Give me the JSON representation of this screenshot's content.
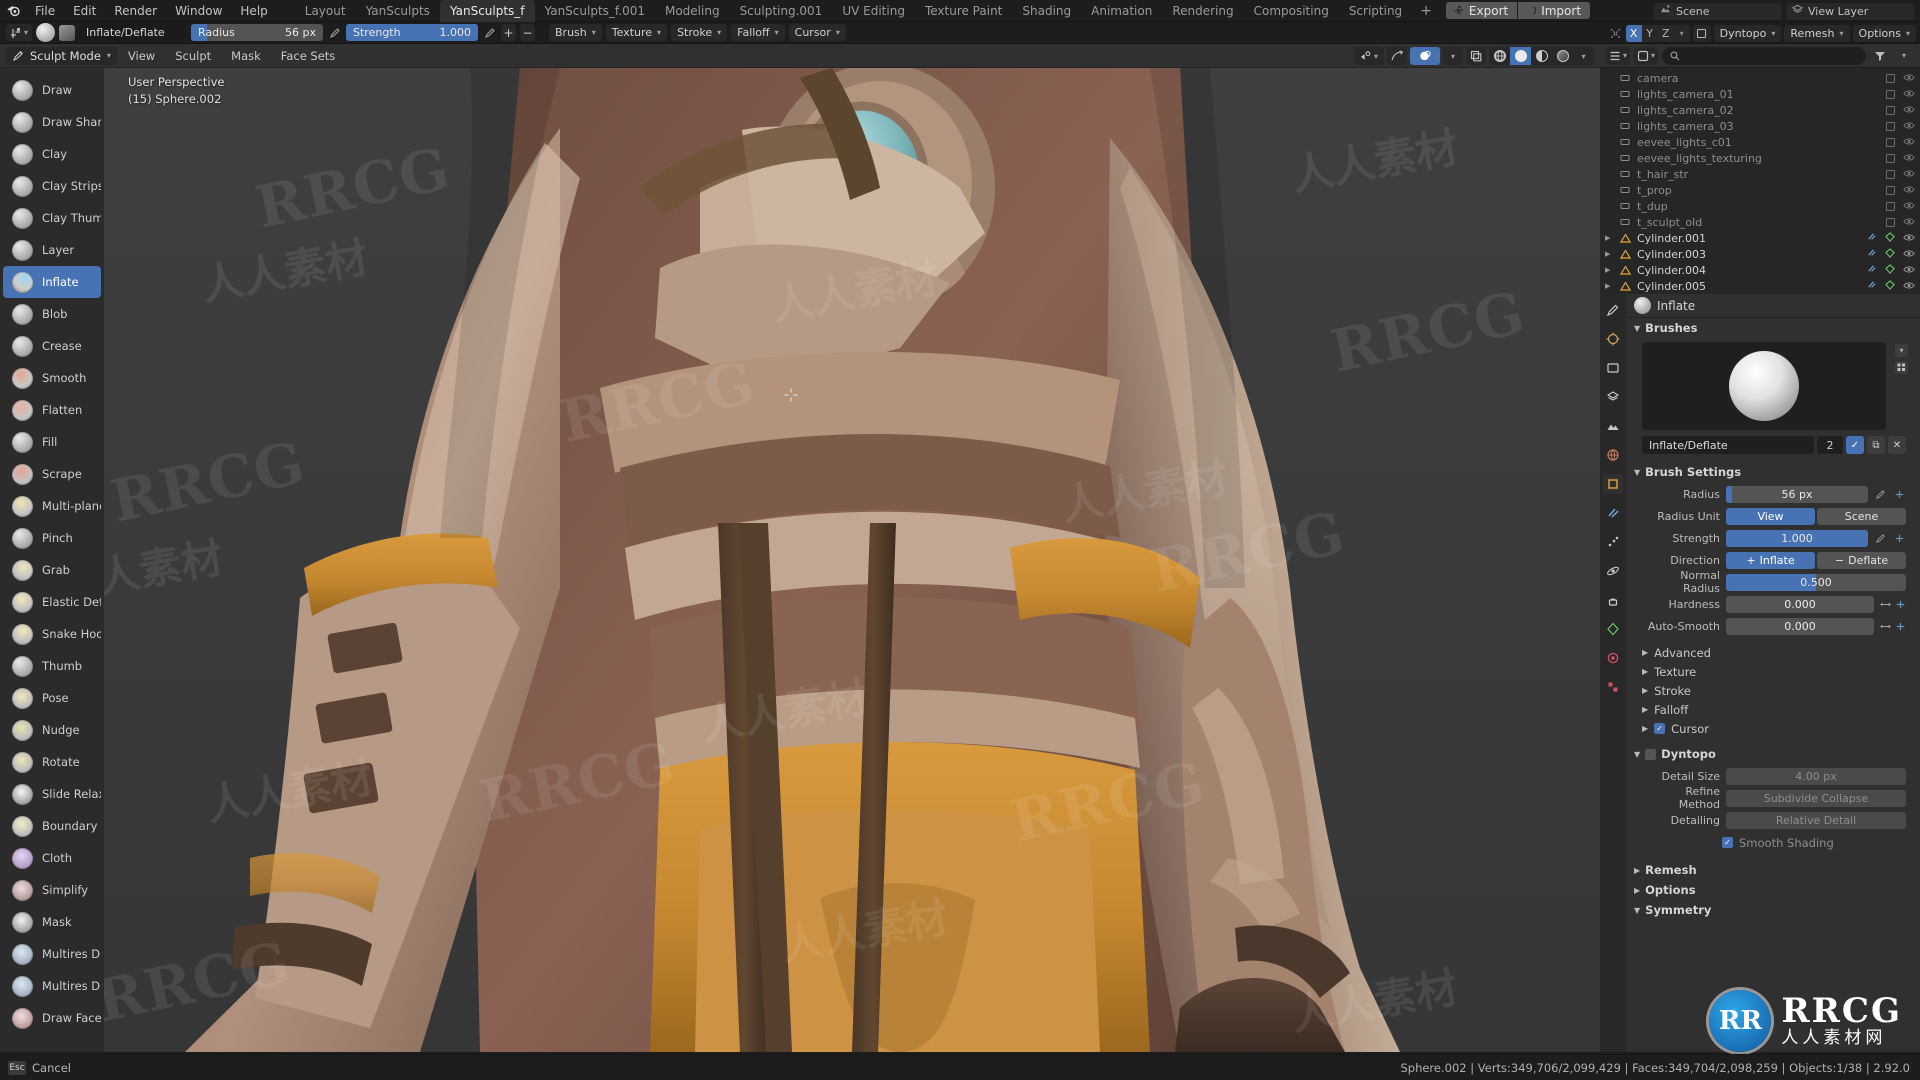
{
  "app": {
    "menus": [
      "File",
      "Edit",
      "Render",
      "Window",
      "Help"
    ],
    "workspace_tabs": [
      {
        "label": "Layout",
        "active": false
      },
      {
        "label": "YanSculpts",
        "active": false
      },
      {
        "label": "YanSculpts_f",
        "active": true
      },
      {
        "label": "YanSculpts_f.001",
        "active": false
      },
      {
        "label": "Modeling",
        "active": false
      },
      {
        "label": "Sculpting.001",
        "active": false
      },
      {
        "label": "UV Editing",
        "active": false
      },
      {
        "label": "Texture Paint",
        "active": false
      },
      {
        "label": "Shading",
        "active": false
      },
      {
        "label": "Animation",
        "active": false
      },
      {
        "label": "Rendering",
        "active": false
      },
      {
        "label": "Compositing",
        "active": false
      },
      {
        "label": "Scripting",
        "active": false
      }
    ],
    "add_workspace": "+",
    "addon_buttons": [
      {
        "label": "Export",
        "icon": "export-person-icon"
      },
      {
        "label": "Import",
        "icon": "import-moon-icon"
      }
    ],
    "scene_field": {
      "icon": "scene-icon",
      "value": "Scene"
    },
    "view_layer_field": {
      "icon": "viewlayer-icon",
      "value": "View Layer"
    }
  },
  "tool_header": {
    "brush_name": "Inflate/Deflate",
    "radius": {
      "label": "Radius",
      "value": "56 px",
      "fill_pct": 12
    },
    "strength": {
      "label": "Strength",
      "value": "1.000",
      "fill_pct": 100
    },
    "plus": "+",
    "minus": "−",
    "dropdowns": [
      "Brush",
      "Texture",
      "Stroke",
      "Falloff",
      "Cursor"
    ],
    "symmetry_axes": [
      {
        "label": "X",
        "on": true
      },
      {
        "label": "Y",
        "on": false
      },
      {
        "label": "Z",
        "on": false
      }
    ],
    "right_dropdowns": [
      "Dyntopo",
      "Remesh",
      "Options"
    ]
  },
  "viewport_header": {
    "mode": "Sculpt Mode",
    "menus": [
      "View",
      "Sculpt",
      "Mask",
      "Face Sets"
    ]
  },
  "viewport": {
    "perspective": "User Perspective",
    "object_info": "(15) Sphere.002",
    "cursor_icon": "crosshair-cursor"
  },
  "brush_toolbar": [
    {
      "label": "Draw",
      "active": false
    },
    {
      "label": "Draw Sharp",
      "active": false
    },
    {
      "label": "Clay",
      "active": false
    },
    {
      "label": "Clay Strips",
      "active": false
    },
    {
      "label": "Clay Thumb",
      "active": false
    },
    {
      "label": "Layer",
      "active": false
    },
    {
      "label": "Inflate",
      "active": true
    },
    {
      "label": "Blob",
      "active": false
    },
    {
      "label": "Crease",
      "active": false
    },
    {
      "label": "Smooth",
      "active": false
    },
    {
      "label": "Flatten",
      "active": false
    },
    {
      "label": "Fill",
      "active": false
    },
    {
      "label": "Scrape",
      "active": false
    },
    {
      "label": "Multi-plane Sc...",
      "active": false
    },
    {
      "label": "Pinch",
      "active": false
    },
    {
      "label": "Grab",
      "active": false
    },
    {
      "label": "Elastic Deform",
      "active": false
    },
    {
      "label": "Snake Hook",
      "active": false
    },
    {
      "label": "Thumb",
      "active": false
    },
    {
      "label": "Pose",
      "active": false
    },
    {
      "label": "Nudge",
      "active": false
    },
    {
      "label": "Rotate",
      "active": false
    },
    {
      "label": "Slide Relax",
      "active": false
    },
    {
      "label": "Boundary",
      "active": false
    },
    {
      "label": "Cloth",
      "active": false
    },
    {
      "label": "Simplify",
      "active": false
    },
    {
      "label": "Mask",
      "active": false
    },
    {
      "label": "Multires Displ...",
      "active": false
    },
    {
      "label": "Multires Displ...",
      "active": false
    },
    {
      "label": "Draw Face Se...",
      "active": false
    }
  ],
  "outliner": {
    "search_placeholder": "",
    "items": [
      {
        "label": "camera",
        "type": "object",
        "dim": true,
        "partial": true
      },
      {
        "label": "lights_camera_01",
        "type": "object",
        "dim": true
      },
      {
        "label": "lights_camera_02",
        "type": "object",
        "dim": true
      },
      {
        "label": "lights_camera_03",
        "type": "object",
        "dim": true
      },
      {
        "label": "eevee_lights_c01",
        "type": "object",
        "dim": true
      },
      {
        "label": "eevee_lights_texturing",
        "type": "object",
        "dim": true
      },
      {
        "label": "t_hair_str",
        "type": "object",
        "dim": true
      },
      {
        "label": "t_prop",
        "type": "object",
        "dim": true
      },
      {
        "label": "t_dup",
        "type": "object",
        "dim": true
      },
      {
        "label": "t_sculpt_old",
        "type": "object",
        "dim": true
      },
      {
        "label": "Cylinder.001",
        "type": "mesh",
        "dim": false
      },
      {
        "label": "Cylinder.003",
        "type": "mesh",
        "dim": false
      },
      {
        "label": "Cylinder.004",
        "type": "mesh",
        "dim": false
      },
      {
        "label": "Cylinder.005",
        "type": "mesh",
        "dim": false
      }
    ]
  },
  "properties": {
    "breadcrumb": "Inflate",
    "brushes_section": "Brushes",
    "brush_id": {
      "name": "Inflate/Deflate",
      "users": "2"
    },
    "brush_settings_section": "Brush Settings",
    "fields": [
      {
        "label": "Radius",
        "value": "56 px",
        "fill_pct": 4,
        "type": "slider"
      },
      {
        "label": "Radius Unit",
        "type": "segmented",
        "options": [
          {
            "label": "View",
            "on": true
          },
          {
            "label": "Scene",
            "on": false
          }
        ]
      },
      {
        "label": "Strength",
        "value": "1.000",
        "fill_pct": 100,
        "type": "slider"
      },
      {
        "label": "Direction",
        "type": "segmented",
        "options": [
          {
            "label": "Inflate",
            "on": true
          },
          {
            "label": "Deflate",
            "on": false
          }
        ]
      },
      {
        "label": "Normal Radius",
        "value": "0.500",
        "fill_pct": 50,
        "type": "slider"
      },
      {
        "label": "Hardness",
        "value": "0.000",
        "fill_pct": 0,
        "type": "slider"
      },
      {
        "label": "Auto-Smooth",
        "value": "0.000",
        "fill_pct": 0,
        "type": "slider"
      }
    ],
    "collapsed_sections": [
      "Advanced",
      "Texture",
      "Stroke",
      "Falloff"
    ],
    "cursor_section": {
      "label": "Cursor",
      "checked": true
    },
    "dyntopo": {
      "label": "Dyntopo",
      "checked": false,
      "rows": [
        {
          "label": "Detail Size",
          "value": "4.00 px"
        },
        {
          "label": "Refine Method",
          "value": "Subdivide Collapse"
        },
        {
          "label": "Detailing",
          "value": "Relative Detail"
        }
      ],
      "smooth_shading": {
        "label": "Smooth Shading",
        "checked": true
      }
    },
    "bottom_sections": [
      "Remesh",
      "Options",
      "Symmetry"
    ]
  },
  "statusbar": {
    "left_key": "Esc",
    "left_label": "Cancel",
    "stats": "Sphere.002 | Verts:349,706/2,099,429 | Faces:349,704/2,098,259 | Objects:1/38 | 2.92.0"
  },
  "watermarks": {
    "latin": "RRCG",
    "cjk": "人人素材",
    "badge": "RR",
    "brand_main": "RRCG",
    "brand_sub": "人人素材网"
  },
  "colors": {
    "accent": "#4772b3",
    "header_bg": "#1d1d1d",
    "panel_bg": "#303030",
    "viewport_bg": "#3b3b3b",
    "outliner_bg": "#262626",
    "toolbar_bg": "#2b2b2b"
  }
}
